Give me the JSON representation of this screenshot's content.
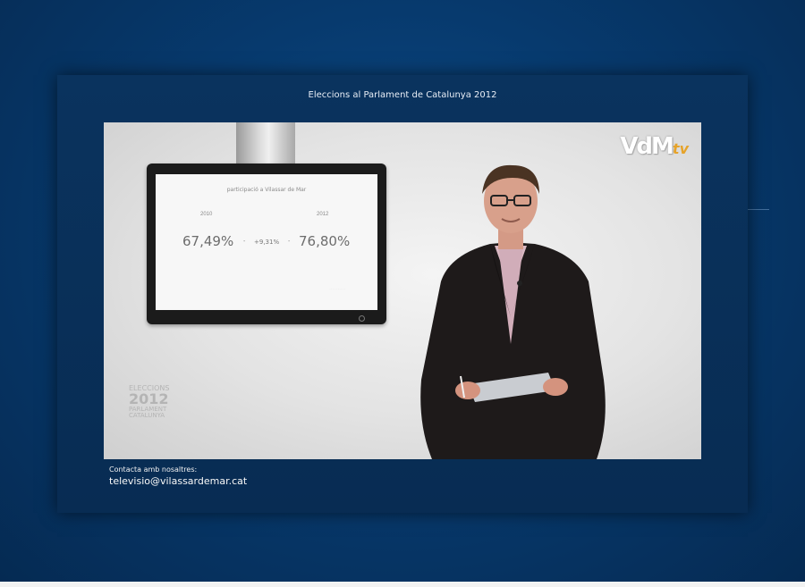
{
  "panel": {
    "title": "Eleccions al Parlament de Catalunya 2012"
  },
  "video": {
    "screen": {
      "title": "participació a Vilassar de Mar",
      "year_left": "2010",
      "year_right": "2012",
      "value_left": "67,49%",
      "change": "+9,31%",
      "value_right": "76,80%",
      "dash": "-"
    },
    "logo": {
      "main": "VdM",
      "sub": "tv"
    },
    "election_mark": {
      "line1": "ELECCIONS",
      "line2": "2012",
      "line3": "PARLAMENT",
      "line4": "CATALUNYA"
    }
  },
  "contact": {
    "label": "Contacta amb nosaltres:",
    "email": "televisio@vilassardemar.cat"
  },
  "colors": {
    "background": "#073a6e",
    "panel": "#0a335e",
    "logo_accent": "#e6a32a"
  }
}
